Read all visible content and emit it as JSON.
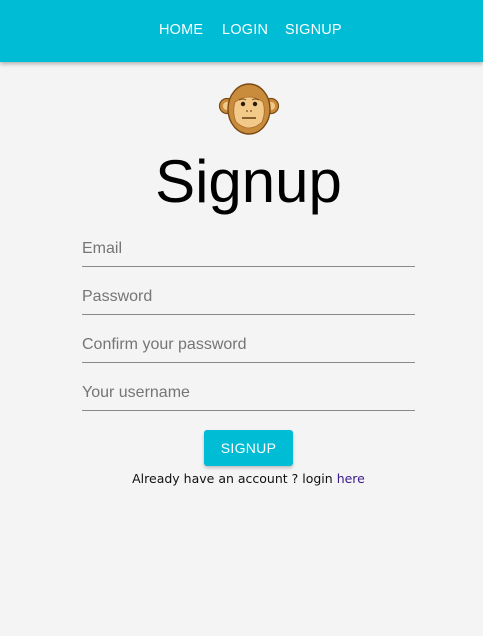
{
  "navbar": {
    "home_label": "HOME",
    "login_label": "LOGIN",
    "signup_label": "SIGNUP",
    "background_color": "#00bcd4"
  },
  "logo": {
    "icon": "monkey-face-icon"
  },
  "page_title": "Signup",
  "form": {
    "email_placeholder": "Email",
    "password_placeholder": "Password",
    "confirm_password_placeholder": "Confirm your password",
    "username_placeholder": "Your username",
    "submit_label": "SIGNUP"
  },
  "footer_hint": {
    "text": "Already have an account ? login ",
    "link_label": "here",
    "link_color": "#3a1a8a"
  }
}
